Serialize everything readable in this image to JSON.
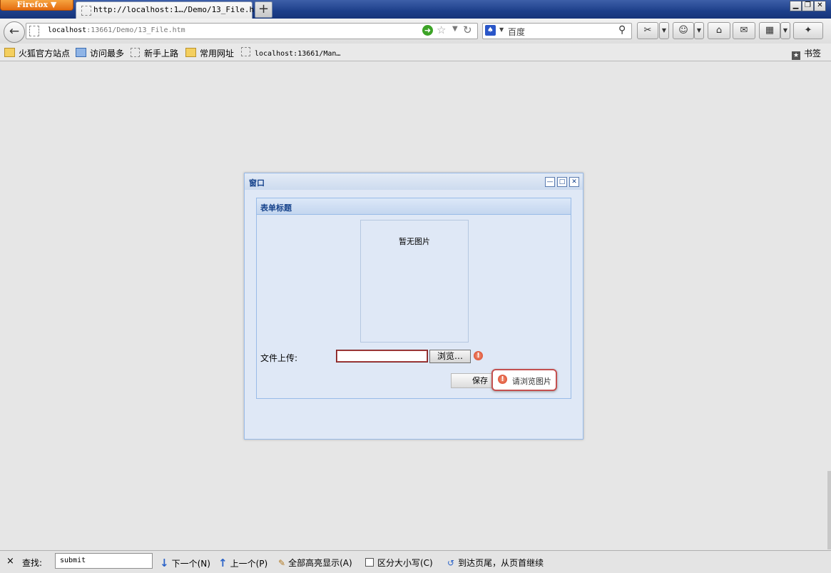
{
  "browser": {
    "app_button": "Firefox ▼",
    "tab_title": "http://localhost:1…/Demo/13_File.htm",
    "new_tab": "+",
    "window_controls": [
      "▁",
      "❐",
      "✕"
    ],
    "url_host": "localhost",
    "url_rest": ":13661/Demo/13_File.htm",
    "search_placeholder": "百度"
  },
  "bookmarks": [
    {
      "label": "火狐官方站点",
      "icon": "folder-icon"
    },
    {
      "label": "访问最多",
      "icon": "history-icon"
    },
    {
      "label": "新手上路",
      "icon": "page-icon"
    },
    {
      "label": "常用网址",
      "icon": "folder-icon"
    },
    {
      "label": "localhost:13661/Man…",
      "icon": "page-icon"
    }
  ],
  "bookmarks_menu": "书签",
  "dialog": {
    "title": "窗口",
    "fieldset_title": "表单标题",
    "no_image_text": "暂无图片",
    "upload_label": "文件上传:",
    "file_value": "",
    "browse_label": "浏览…",
    "save_label": "保存",
    "tooltip": "请浏览图片"
  },
  "findbar": {
    "close": "×",
    "label": "查找:",
    "query": "submit",
    "next": "下一个(N)",
    "prev": "上一个(P)",
    "highlight_all": "全部高亮显示(A)",
    "match_case": "区分大小写(C)",
    "status": "到达页尾，从页首继续"
  }
}
